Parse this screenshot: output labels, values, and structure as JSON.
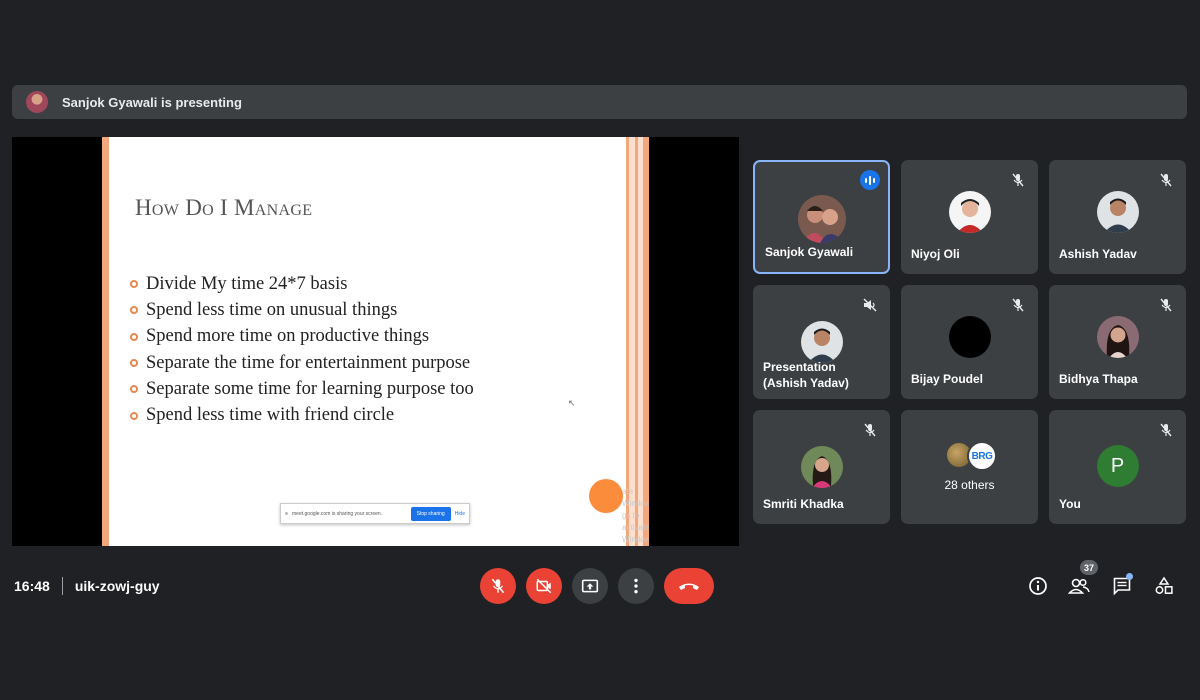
{
  "presenter_bar": {
    "text": "Sanjok Gyawali is presenting"
  },
  "slide": {
    "title": "How Do I Manage",
    "bullets": [
      "Divide My time 24*7 basis",
      "Spend less time on unusual things",
      "Spend more time on productive things",
      "Separate the time for entertainment purpose",
      "Separate some time for learning purpose too",
      "Spend less time with friend circle"
    ],
    "share_banner": {
      "text": "meet.google.com is sharing your screen.",
      "stop_label": "Stop sharing",
      "hide_label": "Hide"
    },
    "watermark": {
      "line1": "ate Windows",
      "line2": "gs to activate Windows."
    }
  },
  "participants": [
    {
      "name": "Sanjok Gyawali",
      "status": "speaking",
      "icon": "audio-level-icon"
    },
    {
      "name": "Niyoj Oli",
      "status": "muted",
      "icon": "mic-off-icon"
    },
    {
      "name": "Ashish Yadav",
      "status": "muted",
      "icon": "mic-off-icon"
    },
    {
      "name_line1": "Presentation",
      "name_line2": "(Ashish Yadav)",
      "status": "audio-muted",
      "icon": "volume-off-icon"
    },
    {
      "name": "Bijay Poudel",
      "status": "muted",
      "icon": "mic-off-icon"
    },
    {
      "name": "Bidhya Thapa",
      "status": "muted",
      "icon": "mic-off-icon"
    },
    {
      "name": "Smriti Khadka",
      "status": "muted",
      "icon": "mic-off-icon"
    },
    {
      "others_label": "28 others",
      "badge_text": "BRG"
    },
    {
      "name": "You",
      "avatar_letter": "P",
      "status": "muted",
      "icon": "mic-off-icon"
    }
  ],
  "bottom_bar": {
    "time": "16:48",
    "meeting_code": "uik-zowj-guy",
    "people_count": "37",
    "controls": [
      "mic-off-icon",
      "camera-off-icon",
      "present-screen-icon",
      "more-options-icon",
      "leave-call-icon"
    ],
    "right_icons": [
      "info-icon",
      "people-icon",
      "chat-icon",
      "activities-icon"
    ]
  },
  "colors": {
    "background": "#202124",
    "tile": "#3c4043",
    "danger": "#ea4335",
    "accent": "#8ab4f8",
    "slide_accent": "#f3a77d"
  }
}
